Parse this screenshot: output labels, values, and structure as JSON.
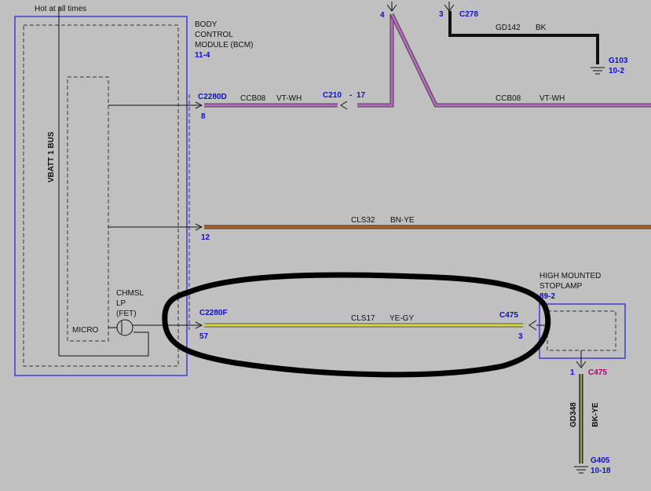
{
  "header_note": "Hot at all times",
  "bcm": {
    "name_lines": [
      "BODY",
      "CONTROL",
      "MODULE (BCM)"
    ],
    "ref": "11-4",
    "bus_label": "VBATT 1 BUS",
    "micro_label": "MICRO",
    "chmsl_lines": [
      "CHMSL",
      "LP",
      "(FET)"
    ]
  },
  "wire_ccb08": {
    "connector": "C2280D",
    "pin": "8",
    "circuit": "CCB08",
    "color": "VT-WH",
    "inline_connector": "C210",
    "inline_dash": "-",
    "inline_pin": "17",
    "upper_pin": "4",
    "right_circuit": "CCB08",
    "right_color": "VT-WH"
  },
  "ground_g103": {
    "pin": "3",
    "connector": "C278",
    "circuit": "GD142",
    "color": "BK",
    "ground": "G103",
    "ref": "10-2"
  },
  "wire_cls32": {
    "pin": "12",
    "circuit": "CLS32",
    "color": "BN-YE"
  },
  "wire_cls17": {
    "connector": "C2280F",
    "pin": "57",
    "circuit": "CLS17",
    "color": "YE-GY",
    "far_connector": "C475",
    "far_pin": "3"
  },
  "stoplamp": {
    "name_lines": [
      "HIGH MOUNTED",
      "STOPLAMP"
    ],
    "ref": "89-2"
  },
  "ground_g405": {
    "pin": "1",
    "connector": "C475",
    "circuit": "GD348",
    "color": "BK-YE",
    "ground": "G405",
    "ref": "10-18"
  },
  "colors": {
    "background": "#c0c0c0",
    "module_outline": "#2a2ad8",
    "wire_vt_wh": "#c063c6",
    "wire_bn_ye": "#b06624",
    "wire_ye_gy": "#d9d935",
    "wire_bk": "#1a1a1a",
    "circle_annotation": "#000000"
  }
}
